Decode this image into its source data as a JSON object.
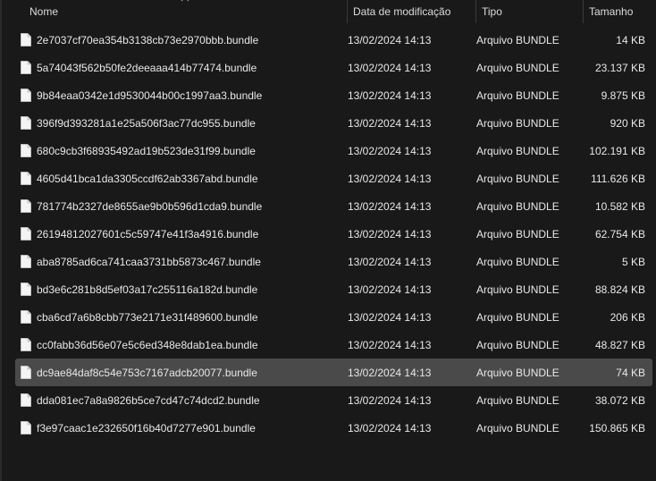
{
  "columns": {
    "name": "Nome",
    "date": "Data de modificação",
    "type": "Tipo",
    "size": "Tamanho"
  },
  "icons": {
    "sort": "chevron-up-icon",
    "file": "file-icon"
  },
  "colors": {
    "background": "#191919",
    "selected_row": "#4a4a4a",
    "text": "#e8e8e8"
  },
  "files": [
    {
      "name": "2e7037cf70ea354b3138cb73e2970bbb.bundle",
      "date": "13/02/2024 14:13",
      "type": "Arquivo BUNDLE",
      "size": "14 KB"
    },
    {
      "name": "5a74043f562b50fe2deeaaa414b77474.bundle",
      "date": "13/02/2024 14:13",
      "type": "Arquivo BUNDLE",
      "size": "23.137 KB"
    },
    {
      "name": "9b84eaa0342e1d9530044b00c1997aa3.bundle",
      "date": "13/02/2024 14:13",
      "type": "Arquivo BUNDLE",
      "size": "9.875 KB"
    },
    {
      "name": "396f9d393281a1e25a506f3ac77dc955.bundle",
      "date": "13/02/2024 14:13",
      "type": "Arquivo BUNDLE",
      "size": "920 KB"
    },
    {
      "name": "680c9cb3f68935492ad19b523de31f99.bundle",
      "date": "13/02/2024 14:13",
      "type": "Arquivo BUNDLE",
      "size": "102.191 KB"
    },
    {
      "name": "4605d41bca1da3305ccdf62ab3367abd.bundle",
      "date": "13/02/2024 14:13",
      "type": "Arquivo BUNDLE",
      "size": "111.626 KB"
    },
    {
      "name": "781774b2327de8655ae9b0b596d1cda9.bundle",
      "date": "13/02/2024 14:13",
      "type": "Arquivo BUNDLE",
      "size": "10.582 KB"
    },
    {
      "name": "26194812027601c5c59747e41f3a4916.bundle",
      "date": "13/02/2024 14:13",
      "type": "Arquivo BUNDLE",
      "size": "62.754 KB"
    },
    {
      "name": "aba8785ad6ca741caa3731bb5873c467.bundle",
      "date": "13/02/2024 14:13",
      "type": "Arquivo BUNDLE",
      "size": "5 KB"
    },
    {
      "name": "bd3e6c281b8d5ef03a17c255116a182d.bundle",
      "date": "13/02/2024 14:13",
      "type": "Arquivo BUNDLE",
      "size": "88.824 KB"
    },
    {
      "name": "cba6cd7a6b8cbb773e2171e31f489600.bundle",
      "date": "13/02/2024 14:13",
      "type": "Arquivo BUNDLE",
      "size": "206 KB"
    },
    {
      "name": "cc0fabb36d56e07e5c6ed348e8dab1ea.bundle",
      "date": "13/02/2024 14:13",
      "type": "Arquivo BUNDLE",
      "size": "48.827 KB"
    },
    {
      "name": "dc9ae84daf8c54e753c7167adcb20077.bundle",
      "date": "13/02/2024 14:13",
      "type": "Arquivo BUNDLE",
      "size": "74 KB",
      "selected": true
    },
    {
      "name": "dda081ec7a8a9826b5ce7cd47c74dcd2.bundle",
      "date": "13/02/2024 14:13",
      "type": "Arquivo BUNDLE",
      "size": "38.072 KB"
    },
    {
      "name": "f3e97caac1e232650f16b40d7277e901.bundle",
      "date": "13/02/2024 14:13",
      "type": "Arquivo BUNDLE",
      "size": "150.865 KB"
    }
  ]
}
